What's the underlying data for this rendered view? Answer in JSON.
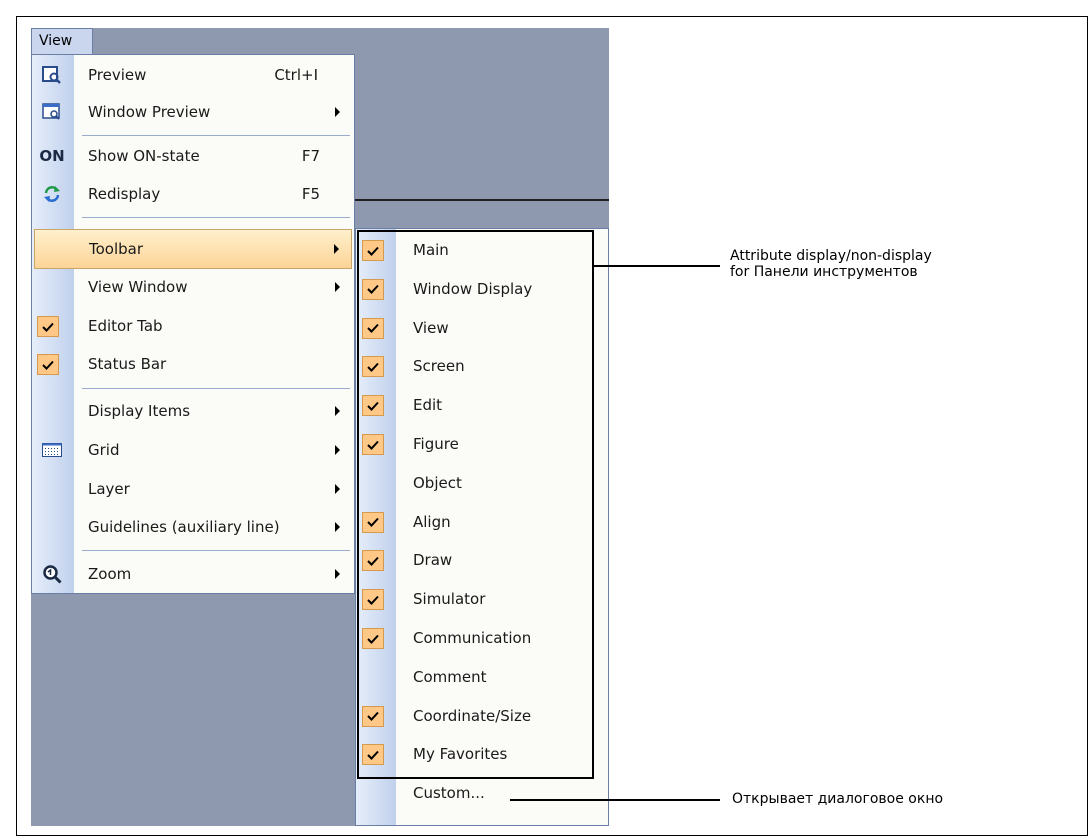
{
  "menubar": {
    "view_label": "View"
  },
  "view_menu": {
    "items": [
      {
        "label": "Preview",
        "shortcut": "Ctrl+I",
        "icon": "preview-icon"
      },
      {
        "label": "Window Preview",
        "has_submenu": true,
        "icon": "window-preview-icon"
      },
      {
        "label": "Show ON-state",
        "shortcut": "F7",
        "icon": "on-state-icon",
        "icon_text": "ON"
      },
      {
        "label": "Redisplay",
        "shortcut": "F5",
        "icon": "redisplay-icon"
      },
      {
        "label": "Toolbar",
        "has_submenu": true,
        "highlighted": true
      },
      {
        "label": "View Window",
        "has_submenu": true
      },
      {
        "label": "Editor Tab",
        "checked": true
      },
      {
        "label": "Status Bar",
        "checked": true
      },
      {
        "label": "Display Items",
        "has_submenu": true
      },
      {
        "label": "Grid",
        "has_submenu": true,
        "icon": "grid-icon"
      },
      {
        "label": "Layer",
        "has_submenu": true
      },
      {
        "label": "Guidelines (auxiliary line)",
        "has_submenu": true
      },
      {
        "label": "Zoom",
        "has_submenu": true,
        "icon": "zoom-icon"
      }
    ]
  },
  "toolbar_menu": {
    "items": [
      {
        "label": "Main",
        "checked": true
      },
      {
        "label": "Window Display",
        "checked": true
      },
      {
        "label": "View",
        "checked": true
      },
      {
        "label": "Screen",
        "checked": true
      },
      {
        "label": "Edit",
        "checked": true
      },
      {
        "label": "Figure",
        "checked": true
      },
      {
        "label": "Object",
        "checked": false
      },
      {
        "label": "Align",
        "checked": true
      },
      {
        "label": "Draw",
        "checked": true
      },
      {
        "label": "Simulator",
        "checked": true
      },
      {
        "label": "Communication",
        "checked": true
      },
      {
        "label": "Comment",
        "checked": false
      },
      {
        "label": "Coordinate/Size",
        "checked": true
      },
      {
        "label": "My Favorites",
        "checked": true
      },
      {
        "label": "Custom...",
        "checked": false
      }
    ]
  },
  "annotations": {
    "toolbar_note_line1": "Attribute display/non-display",
    "toolbar_note_line2": "for Панели инструментов",
    "custom_note": "Открывает диалоговое окно"
  },
  "colors": {
    "app_background": "#8e99b0",
    "highlight": "#fcd497",
    "check_background": "#ffc886",
    "menu_border": "#6b7fa6"
  }
}
